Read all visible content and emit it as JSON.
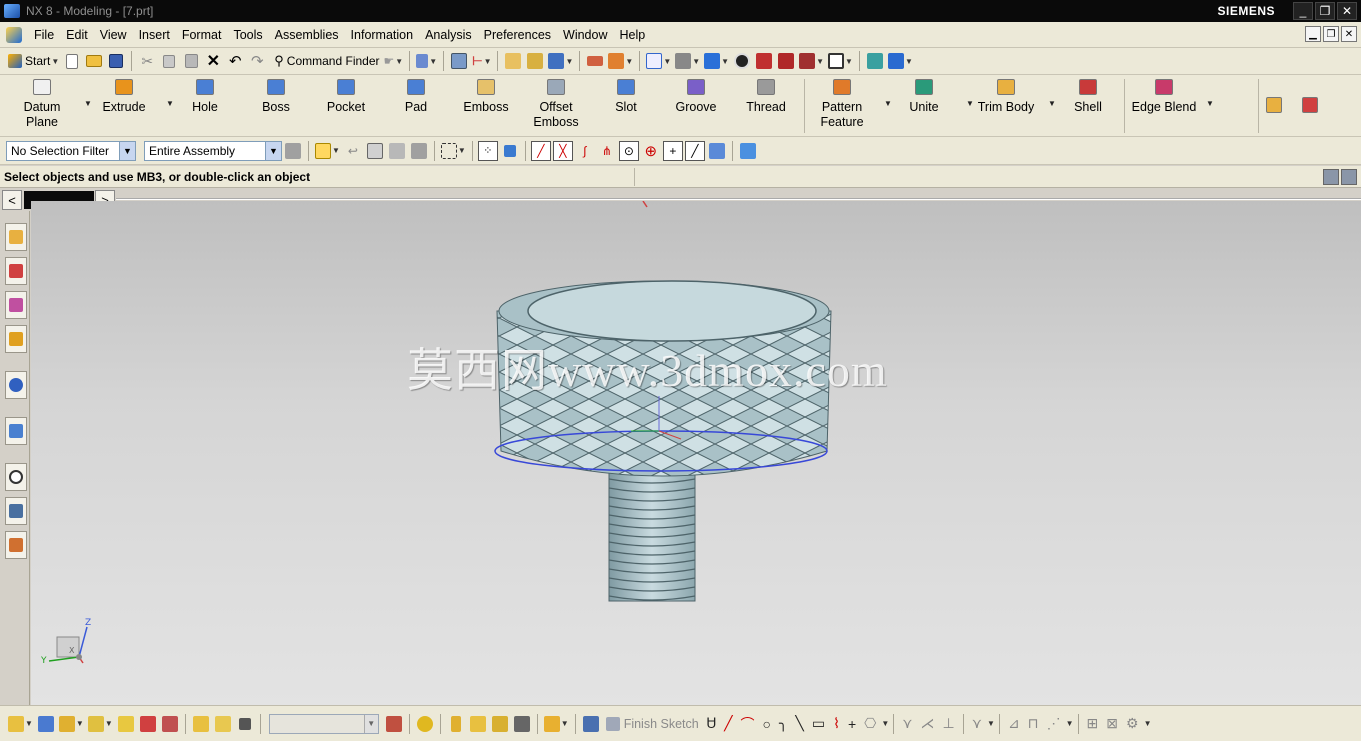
{
  "window": {
    "title": "NX 8 - Modeling - [7.prt]",
    "brand": "SIEMENS",
    "buttons": [
      "_",
      "❐",
      "✕"
    ]
  },
  "menu": {
    "items": [
      "File",
      "Edit",
      "View",
      "Insert",
      "Format",
      "Tools",
      "Assemblies",
      "Information",
      "Analysis",
      "Preferences",
      "Window",
      "Help"
    ]
  },
  "standard_toolbar": {
    "start_label": "Start",
    "command_finder_label": "Command Finder"
  },
  "feature_toolbar": {
    "items": [
      {
        "line1": "Datum",
        "line2": "Plane",
        "icon": "datum-plane-icon",
        "color": "#f0f0f0"
      },
      {
        "line1": "Extrude",
        "line2": "",
        "icon": "extrude-icon",
        "color": "#e8931c"
      },
      {
        "line1": "Hole",
        "line2": "",
        "icon": "hole-icon",
        "color": "#4a7fd4"
      },
      {
        "line1": "Boss",
        "line2": "",
        "icon": "boss-icon",
        "color": "#4a7fd4"
      },
      {
        "line1": "Pocket",
        "line2": "",
        "icon": "pocket-icon",
        "color": "#4a7fd4"
      },
      {
        "line1": "Pad",
        "line2": "",
        "icon": "pad-icon",
        "color": "#4a7fd4"
      },
      {
        "line1": "Emboss",
        "line2": "",
        "icon": "emboss-icon",
        "color": "#e6c16a"
      },
      {
        "line1": "Offset",
        "line2": "Emboss",
        "icon": "offset-emboss-icon",
        "color": "#9aa8b8"
      },
      {
        "line1": "Slot",
        "line2": "",
        "icon": "slot-icon",
        "color": "#4a7fd4"
      },
      {
        "line1": "Groove",
        "line2": "",
        "icon": "groove-icon",
        "color": "#7a5fc8"
      },
      {
        "line1": "Thread",
        "line2": "",
        "icon": "thread-icon",
        "color": "#9a9a9a"
      },
      {
        "line1": "Pattern",
        "line2": "Feature",
        "icon": "pattern-feature-icon",
        "color": "#e07a2a"
      },
      {
        "line1": "Unite",
        "line2": "",
        "icon": "unite-icon",
        "color": "#2a9a7a"
      },
      {
        "line1": "Trim Body",
        "line2": "",
        "icon": "trim-body-icon",
        "color": "#e8b040"
      },
      {
        "line1": "Shell",
        "line2": "",
        "icon": "shell-icon",
        "color": "#c83a3a"
      },
      {
        "line1": "Edge Blend",
        "line2": "",
        "icon": "edge-blend-icon",
        "color": "#c83a6a"
      }
    ]
  },
  "selection_bar": {
    "filter_value": "No Selection Filter",
    "scope_value": "Entire Assembly"
  },
  "cue_line": {
    "message": "Select objects and use MB3, or double-click an object"
  },
  "graphics": {
    "watermark": "莫西网www.3dmox.com",
    "triad_axes": {
      "z": "Z",
      "y": "Y",
      "x": "X"
    }
  },
  "bottom_toolbar": {
    "finish_sketch_label": "Finish Sketch"
  }
}
